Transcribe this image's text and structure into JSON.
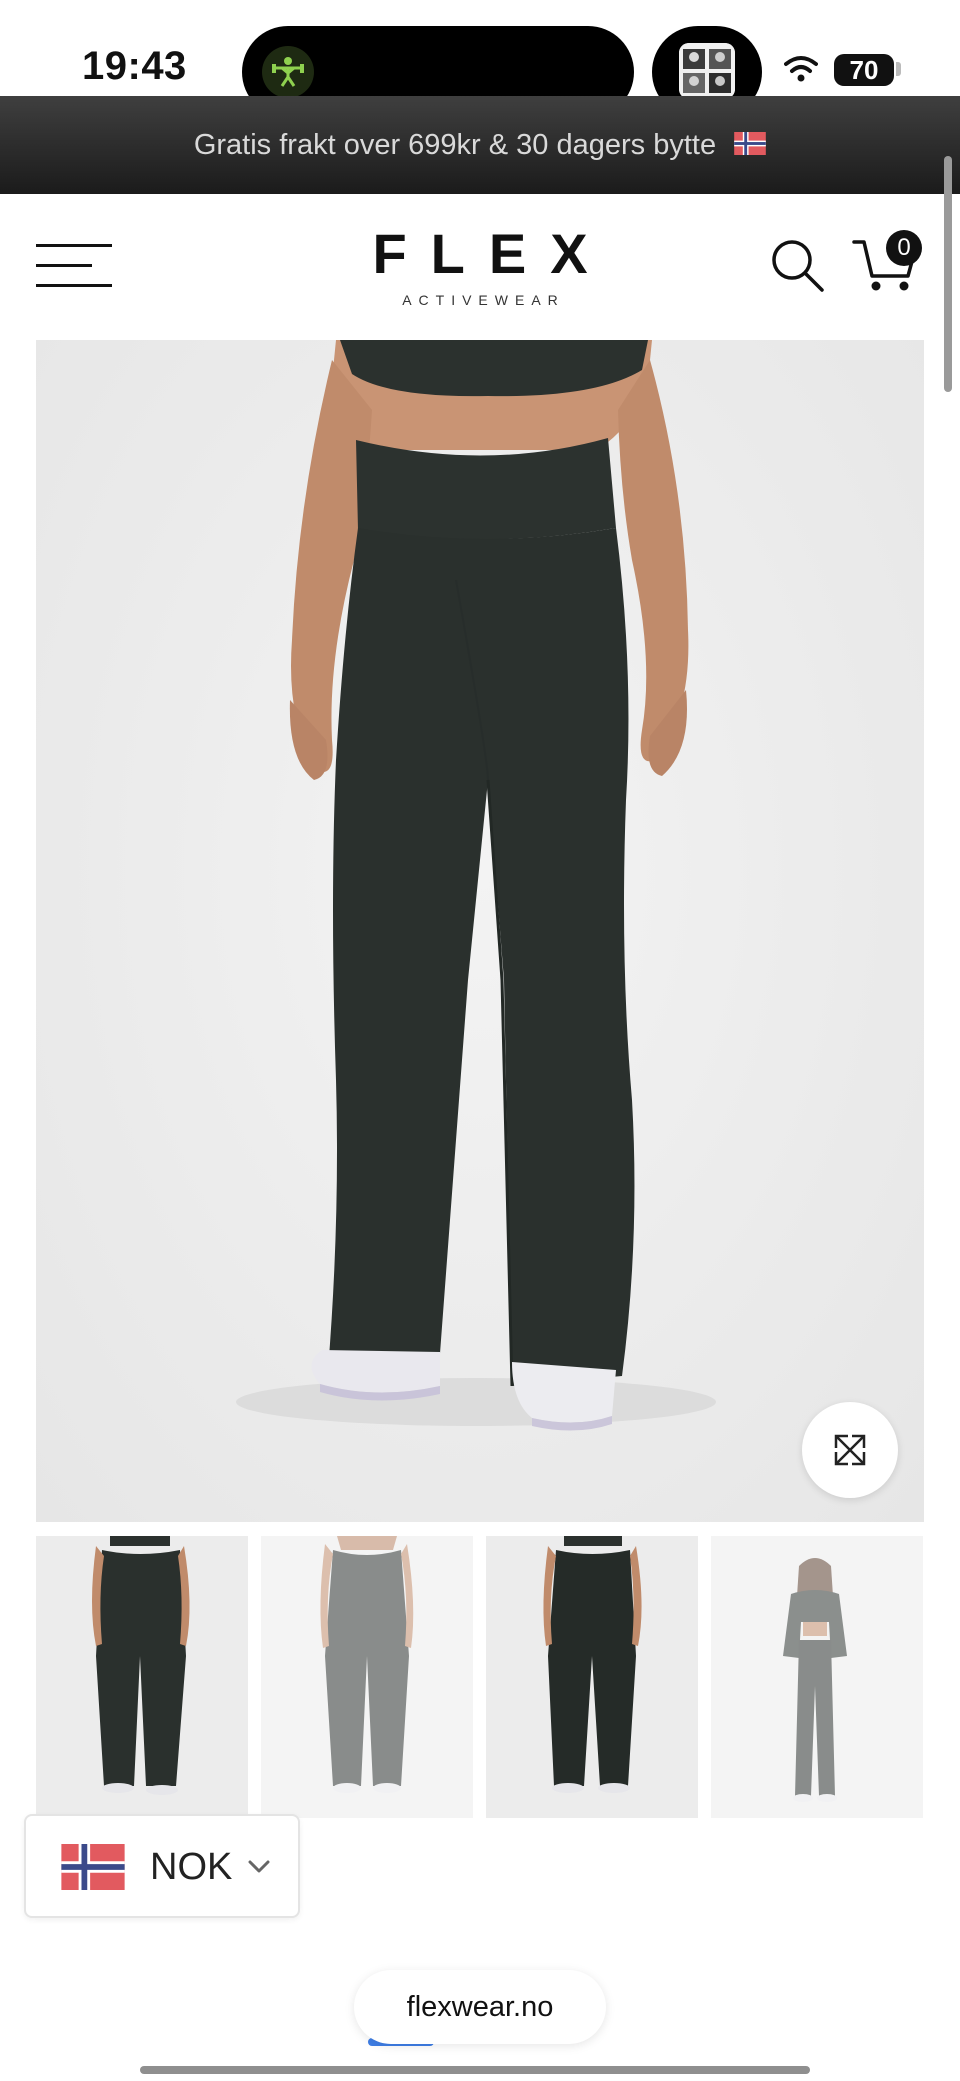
{
  "status_bar": {
    "time": "19:43",
    "battery": "70",
    "icons": [
      "workout-activity-icon",
      "now-playing-art",
      "wifi-icon",
      "battery-icon"
    ]
  },
  "announcement": {
    "text": "Gratis frakt over 699kr & 30 dagers bytte",
    "flag_icon": "norway-flag-icon"
  },
  "header": {
    "logo_main": "FLEX",
    "logo_sub": "ACTIVEWEAR",
    "menu_icon": "hamburger-menu-icon",
    "search_icon": "search-icon",
    "cart_icon": "cart-icon",
    "cart_count": "0"
  },
  "gallery": {
    "main_image_icon": "product-photo-wide-leg-pants",
    "zoom_icon": "expand-icon",
    "thumbnails": [
      {
        "name": "front view",
        "selected": true
      },
      {
        "name": "back view",
        "selected": false
      },
      {
        "name": "front view dark",
        "selected": false
      },
      {
        "name": "full outfit",
        "selected": false
      }
    ]
  },
  "currency": {
    "code": "NOK",
    "flag_icon": "norway-flag-icon",
    "chevron_icon": "chevron-down-icon"
  },
  "browser": {
    "url": "flexwear.no"
  },
  "colors": {
    "accent": "#3e7ee6",
    "announcement_bg": "#2b2b2b",
    "pants": "#2a302d",
    "norway_red": "#e25a5f",
    "norway_blue": "#3b4a8a"
  }
}
